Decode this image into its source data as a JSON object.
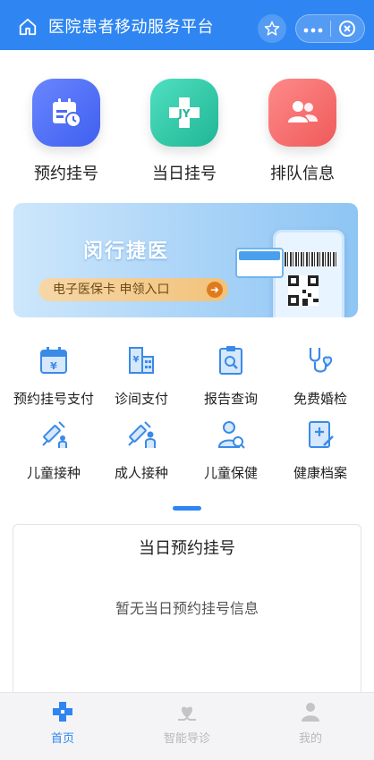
{
  "header": {
    "title": "医院患者移动服务平台",
    "icons": [
      "home-icon",
      "star-icon",
      "more-icon",
      "close-icon"
    ]
  },
  "quick": [
    {
      "label": "预约挂号",
      "icon": "calendar-clock-icon",
      "color": "#4b6cf0"
    },
    {
      "label": "当日挂号",
      "icon": "medical-cross-icon",
      "color": "#2fc7a8"
    },
    {
      "label": "排队信息",
      "icon": "people-icon",
      "color": "#f36464"
    }
  ],
  "banner": {
    "title": "闵行捷医",
    "button": "电子医保卡 申领入口"
  },
  "services": [
    {
      "label": "预约挂号支付",
      "icon": "calendar-yen-icon"
    },
    {
      "label": "诊间支付",
      "icon": "building-yen-icon"
    },
    {
      "label": "报告查询",
      "icon": "report-search-icon"
    },
    {
      "label": "免费婚检",
      "icon": "stethoscope-heart-icon"
    },
    {
      "label": "儿童接种",
      "icon": "syringe-child-icon"
    },
    {
      "label": "成人接种",
      "icon": "syringe-adult-icon"
    },
    {
      "label": "儿童保健",
      "icon": "child-care-icon"
    },
    {
      "label": "健康档案",
      "icon": "health-record-icon"
    }
  ],
  "appointment": {
    "title": "当日预约挂号",
    "empty": "暂无当日预约挂号信息"
  },
  "tabs": [
    {
      "label": "首页",
      "icon": "home-cross-icon",
      "active": true
    },
    {
      "label": "智能导诊",
      "icon": "heart-hand-icon",
      "active": false
    },
    {
      "label": "我的",
      "icon": "user-icon",
      "active": false
    }
  ],
  "colors": {
    "primary": "#2f86f2",
    "icon_blue": "#3a8ae8",
    "tab_inactive": "#b8b8b8"
  }
}
